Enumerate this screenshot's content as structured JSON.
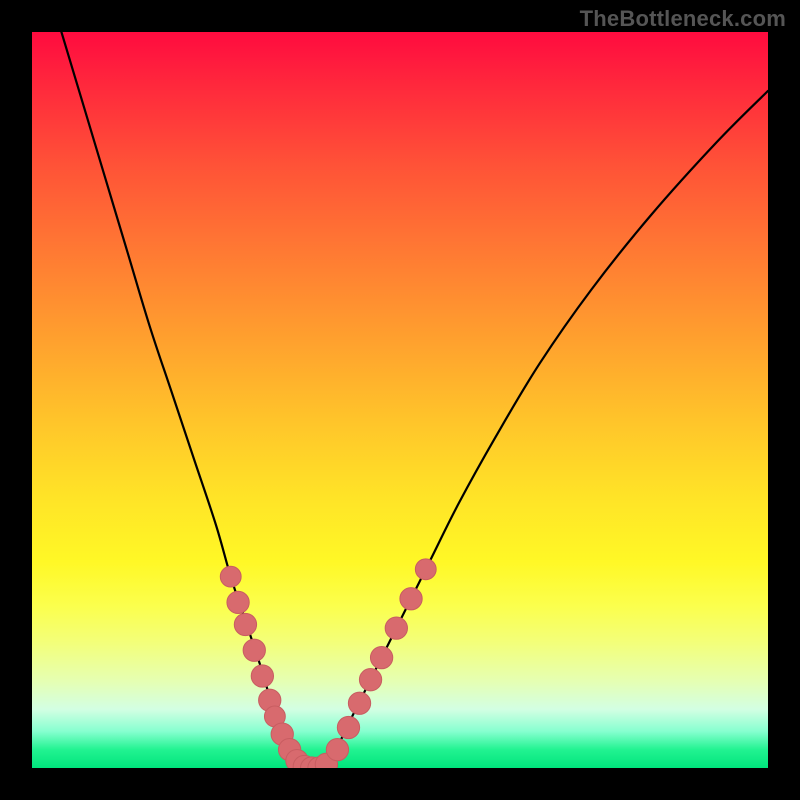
{
  "watermark": "TheBottleneck.com",
  "colors": {
    "frame": "#000000",
    "curve": "#000000",
    "marker_fill": "#d86a6e",
    "marker_stroke": "#c85d61"
  },
  "chart_data": {
    "type": "line",
    "title": "",
    "xlabel": "",
    "ylabel": "",
    "xlim": [
      0,
      100
    ],
    "ylim": [
      0,
      100
    ],
    "grid": false,
    "legend": false,
    "notes": "V-shaped bottleneck curve; y is normalized mismatch (0 at optimum). No axis ticks or labels rendered.",
    "series": [
      {
        "name": "curve",
        "x": [
          4,
          7,
          10,
          13,
          16,
          19,
          22,
          25,
          27,
          29,
          31,
          32.5,
          34,
          35.5,
          37,
          39,
          41,
          43,
          46,
          50,
          54,
          58,
          63,
          69,
          76,
          84,
          93,
          100
        ],
        "y": [
          100,
          90,
          80,
          70,
          60,
          51,
          42,
          33,
          26,
          20,
          14,
          9,
          5,
          2,
          0,
          0,
          2,
          6,
          12,
          20,
          28,
          36,
          45,
          55,
          65,
          75,
          85,
          92
        ]
      }
    ],
    "markers": [
      {
        "x": 27.0,
        "y": 26.0,
        "r": 1.2
      },
      {
        "x": 28.0,
        "y": 22.5,
        "r": 1.4
      },
      {
        "x": 29.0,
        "y": 19.5,
        "r": 1.4
      },
      {
        "x": 30.2,
        "y": 16.0,
        "r": 1.4
      },
      {
        "x": 31.3,
        "y": 12.5,
        "r": 1.4
      },
      {
        "x": 32.3,
        "y": 9.2,
        "r": 1.4
      },
      {
        "x": 33.0,
        "y": 7.0,
        "r": 1.2
      },
      {
        "x": 34.0,
        "y": 4.6,
        "r": 1.4
      },
      {
        "x": 35.0,
        "y": 2.5,
        "r": 1.4
      },
      {
        "x": 36.0,
        "y": 1.0,
        "r": 1.4
      },
      {
        "x": 37.0,
        "y": 0.2,
        "r": 1.4
      },
      {
        "x": 38.0,
        "y": 0.0,
        "r": 1.4
      },
      {
        "x": 39.0,
        "y": 0.0,
        "r": 1.4
      },
      {
        "x": 40.0,
        "y": 0.5,
        "r": 1.4
      },
      {
        "x": 41.5,
        "y": 2.5,
        "r": 1.4
      },
      {
        "x": 43.0,
        "y": 5.5,
        "r": 1.4
      },
      {
        "x": 44.5,
        "y": 8.8,
        "r": 1.4
      },
      {
        "x": 46.0,
        "y": 12.0,
        "r": 1.4
      },
      {
        "x": 47.5,
        "y": 15.0,
        "r": 1.4
      },
      {
        "x": 49.5,
        "y": 19.0,
        "r": 1.4
      },
      {
        "x": 51.5,
        "y": 23.0,
        "r": 1.4
      },
      {
        "x": 53.5,
        "y": 27.0,
        "r": 1.2
      }
    ]
  }
}
